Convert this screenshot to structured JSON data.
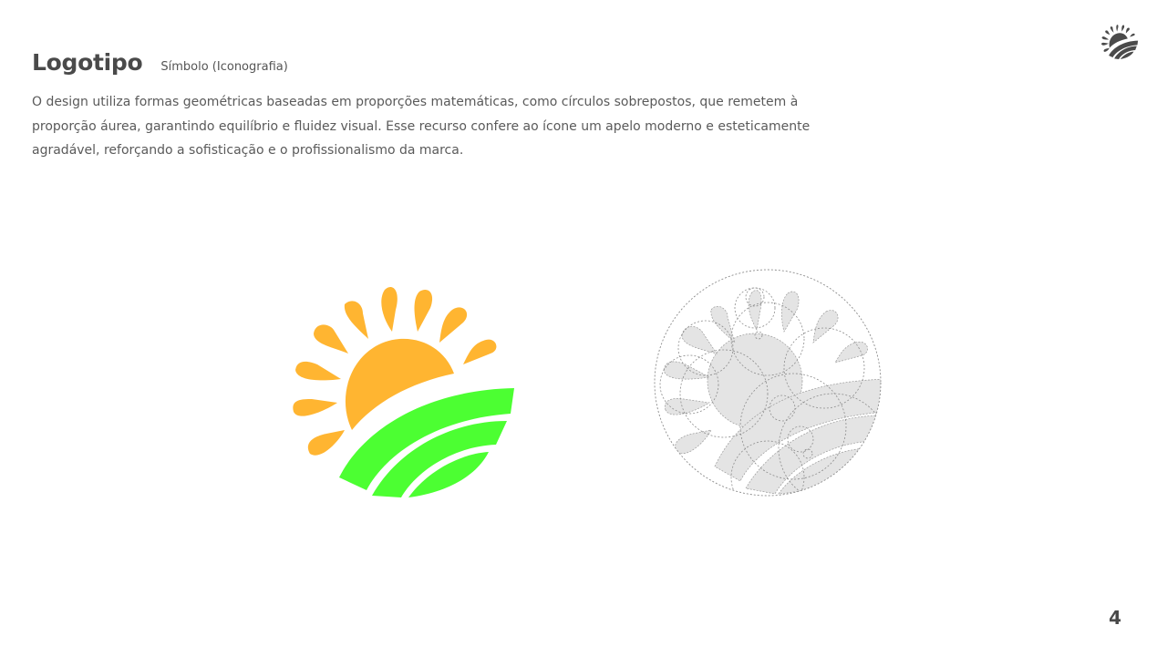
{
  "header": {
    "title": "Logotipo",
    "subtitle": "Símbolo (Iconografia)"
  },
  "description": "O design utiliza formas geométricas baseadas em proporções matemáticas, como círculos sobrepostos, que remetem à proporção áurea, garantindo equilíbrio e fluidez visual. Esse recurso confere ao ícone um apelo moderno e esteticamente agradável, reforçando a sofisticação e o profissionalismo da marca.",
  "page_number": "4",
  "colors": {
    "sun": "#ffb531",
    "field": "#4cff32",
    "text": "#4a4a4a",
    "construction_fill": "#e4e4e4",
    "construction_line": "#8c8c8c",
    "corner_logo": "#4a4a4a"
  },
  "icons": {
    "corner_logo": "sun-field-logo-icon",
    "main_logo": "sun-field-logo-icon",
    "construction": "logo-construction-grid-icon"
  }
}
